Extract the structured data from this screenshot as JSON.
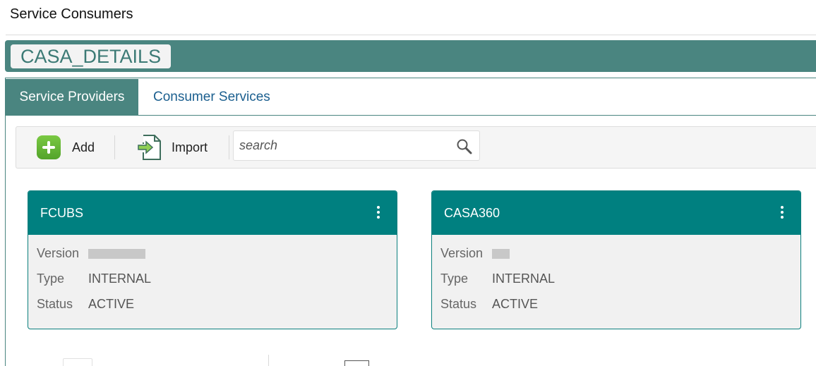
{
  "page": {
    "title": "Service Consumers"
  },
  "header": {
    "name": "CASA_DETAILS"
  },
  "tabs": [
    {
      "label": "Service Providers",
      "active": true
    },
    {
      "label": "Consumer Services",
      "active": false
    }
  ],
  "toolbar": {
    "add_label": "Add",
    "import_label": "Import",
    "search": {
      "placeholder": "search",
      "value": ""
    }
  },
  "cards": [
    {
      "name": "FCUBS",
      "version_label": "Version",
      "version_value_redacted": true,
      "type_label": "Type",
      "type_value": "INTERNAL",
      "status_label": "Status",
      "status_value": "ACTIVE"
    },
    {
      "name": "CASA360",
      "version_label": "Version",
      "version_value_redacted": true,
      "type_label": "Type",
      "type_value": "INTERNAL",
      "status_label": "Status",
      "status_value": "ACTIVE"
    }
  ],
  "icons": [
    "add-icon",
    "import-icon",
    "search-icon",
    "kebab-menu-icon"
  ],
  "colors": {
    "header_bg": "#4a8580",
    "card_header_bg": "#008080",
    "tab_link": "#1b5f8f",
    "add_green": "#6cbf3a"
  }
}
